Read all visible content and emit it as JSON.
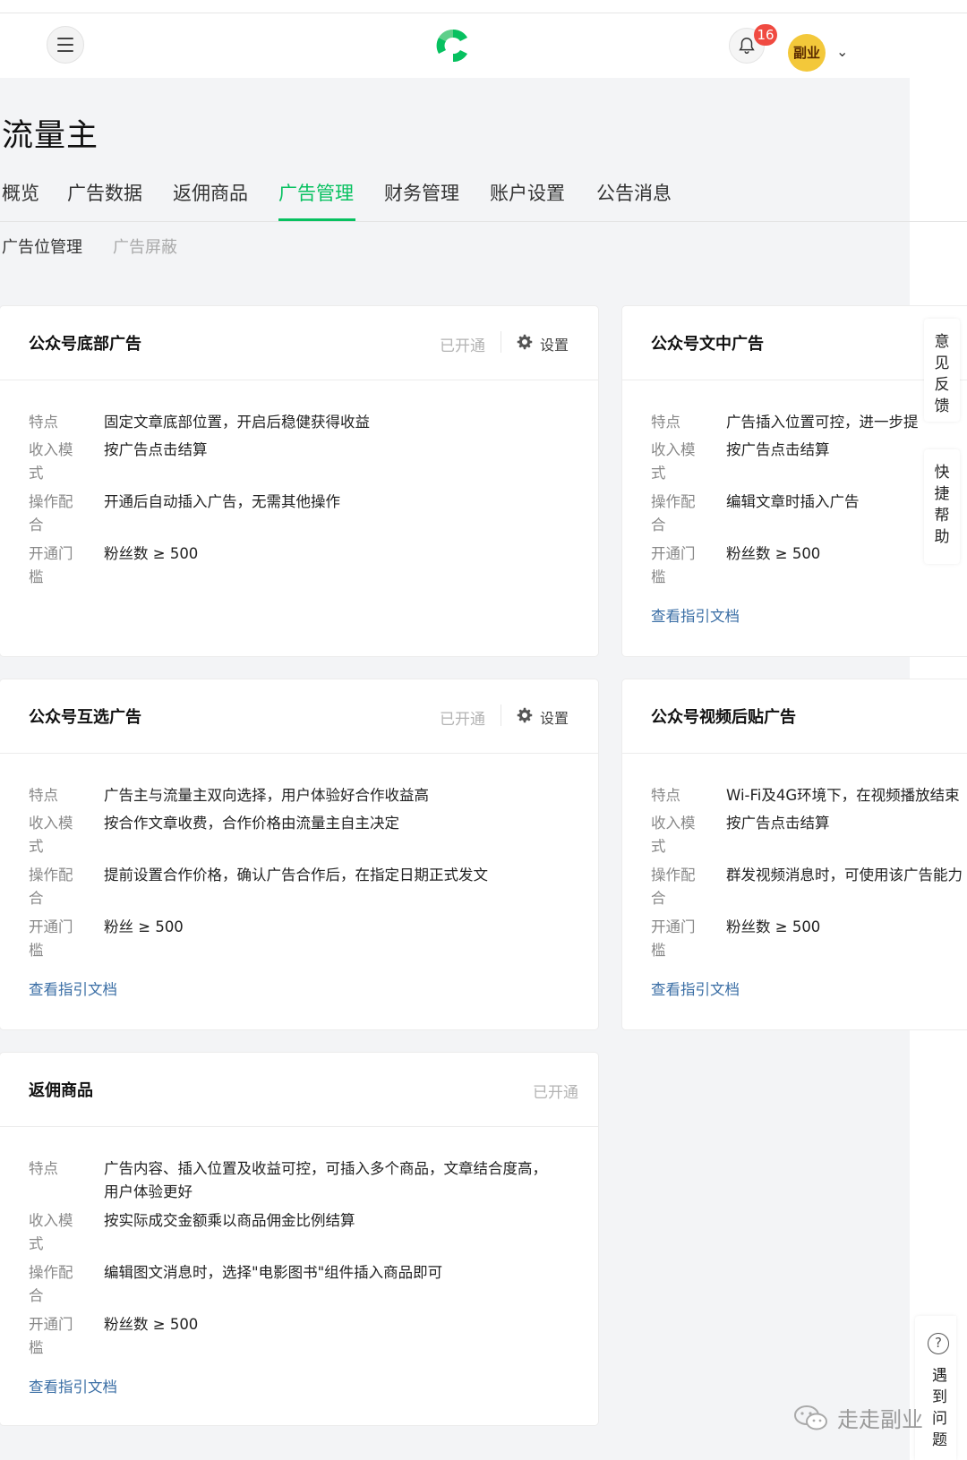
{
  "header": {
    "notification_count": "16",
    "avatar_text": "副业",
    "caret": "⌄"
  },
  "page_title": "流量主",
  "tabs": [
    "概览",
    "广告数据",
    "返佣商品",
    "广告管理",
    "财务管理",
    "账户设置",
    "公告消息"
  ],
  "active_tab": "广告管理",
  "subtabs": [
    "广告位管理",
    "广告屏蔽"
  ],
  "labels": {
    "feature": "特点",
    "income": "收入模式",
    "operation": "操作配合",
    "threshold": "开通门槛"
  },
  "status_opened": "已开通",
  "settings_label": "设置",
  "guide_link": "查看指引文档",
  "cards": [
    {
      "title": "公众号底部广告",
      "feature": "固定文章底部位置，开启后稳健获得收益",
      "income": "按广告点击结算",
      "operation": "开通后自动插入广告，无需其他操作",
      "threshold": "粉丝数 ≥ 500"
    },
    {
      "title": "公众号文中广告",
      "feature": "广告插入位置可控，进一步提",
      "income": "按广告点击结算",
      "operation": "编辑文章时插入广告",
      "threshold": "粉丝数 ≥ 500"
    },
    {
      "title": "公众号互选广告",
      "feature": "广告主与流量主双向选择，用户体验好合作收益高",
      "income": "按合作文章收费，合作价格由流量主自主决定",
      "operation": "提前设置合作价格，确认广告合作后，在指定日期正式发文",
      "threshold": "粉丝 ≥ 500"
    },
    {
      "title": "公众号视频后贴广告",
      "feature": "Wi-Fi及4G环境下，在视频播放结束",
      "income": "按广告点击结算",
      "operation": "群发视频消息时，可使用该广告能力",
      "threshold": "粉丝数 ≥ 500"
    },
    {
      "title": "返佣商品",
      "feature": "广告内容、插入位置及收益可控，可插入多个商品，文章结合度高，用户体验更好",
      "income": "按实际成交金额乘以商品佣金比例结算",
      "operation": "编辑图文消息时，选择\"电影图书\"组件插入商品即可",
      "threshold": "粉丝数 ≥ 500"
    }
  ],
  "side": {
    "feedback": "意见反馈",
    "quick_help": "快捷帮助",
    "problem": "遇到问题",
    "help_symbol": "?"
  },
  "watermark": "走走副业"
}
